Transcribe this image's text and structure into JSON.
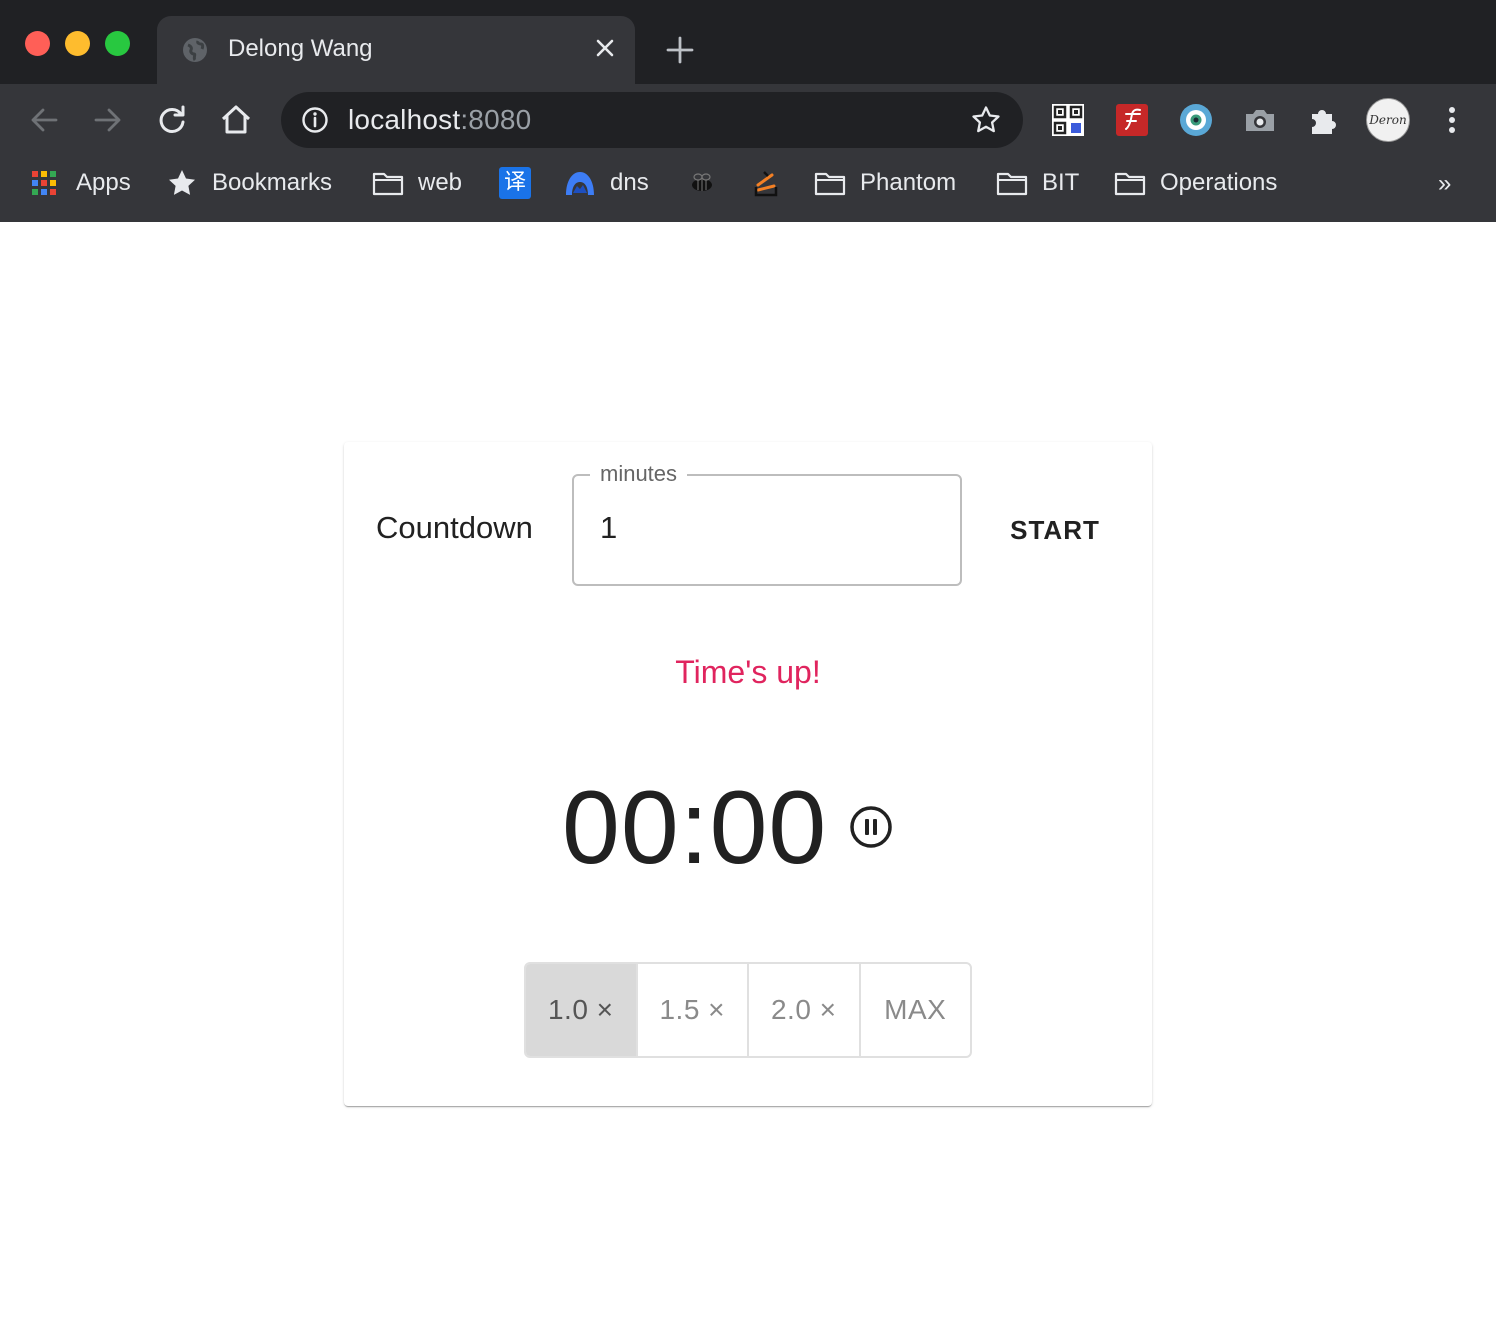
{
  "browser": {
    "tab": {
      "title": "Delong Wang"
    },
    "address": {
      "host": "localhost",
      "port": ":8080"
    },
    "profile": {
      "avatar_text": "Deron"
    },
    "bookmarks": [
      {
        "label": "Apps",
        "icon": "apps-grid-icon"
      },
      {
        "label": "Bookmarks",
        "icon": "star-icon"
      },
      {
        "label": "web",
        "icon": "folder-icon"
      },
      {
        "label": "",
        "icon": "translate-icon",
        "icon_text": "译"
      },
      {
        "label": "dns",
        "icon": "dns-arc-icon"
      },
      {
        "label": "",
        "icon": "bee-icon"
      },
      {
        "label": "",
        "icon": "stack-logo-icon"
      },
      {
        "label": "Phantom",
        "icon": "folder-icon"
      },
      {
        "label": "BIT",
        "icon": "folder-icon"
      },
      {
        "label": "Operations",
        "icon": "folder-icon"
      }
    ],
    "bookmarks_overflow": "»",
    "colors": {
      "chrome_dark": "#202124",
      "chrome_toolbar": "#35363a",
      "text": "#e8eaed"
    }
  },
  "countdown": {
    "label": "Countdown",
    "field": {
      "legend": "minutes",
      "value": "1"
    },
    "start_label": "START",
    "status_message": "Time's up!",
    "time_display": "00:00",
    "speeds": [
      {
        "label": "1.0 ×",
        "selected": true
      },
      {
        "label": "1.5 ×",
        "selected": false
      },
      {
        "label": "2.0 ×",
        "selected": false
      },
      {
        "label": "MAX",
        "selected": false
      }
    ],
    "colors": {
      "status": "#e0245e",
      "selected_speed_bg": "#d9d9d9"
    }
  }
}
